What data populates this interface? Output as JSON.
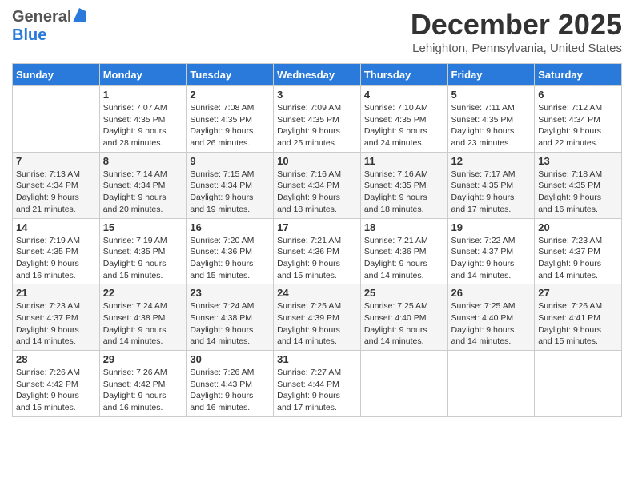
{
  "header": {
    "logo_general": "General",
    "logo_blue": "Blue",
    "month": "December 2025",
    "location": "Lehighton, Pennsylvania, United States"
  },
  "days_of_week": [
    "Sunday",
    "Monday",
    "Tuesday",
    "Wednesday",
    "Thursday",
    "Friday",
    "Saturday"
  ],
  "weeks": [
    [
      {
        "day": "",
        "info": ""
      },
      {
        "day": "1",
        "info": "Sunrise: 7:07 AM\nSunset: 4:35 PM\nDaylight: 9 hours\nand 28 minutes."
      },
      {
        "day": "2",
        "info": "Sunrise: 7:08 AM\nSunset: 4:35 PM\nDaylight: 9 hours\nand 26 minutes."
      },
      {
        "day": "3",
        "info": "Sunrise: 7:09 AM\nSunset: 4:35 PM\nDaylight: 9 hours\nand 25 minutes."
      },
      {
        "day": "4",
        "info": "Sunrise: 7:10 AM\nSunset: 4:35 PM\nDaylight: 9 hours\nand 24 minutes."
      },
      {
        "day": "5",
        "info": "Sunrise: 7:11 AM\nSunset: 4:35 PM\nDaylight: 9 hours\nand 23 minutes."
      },
      {
        "day": "6",
        "info": "Sunrise: 7:12 AM\nSunset: 4:34 PM\nDaylight: 9 hours\nand 22 minutes."
      }
    ],
    [
      {
        "day": "7",
        "info": "Sunrise: 7:13 AM\nSunset: 4:34 PM\nDaylight: 9 hours\nand 21 minutes."
      },
      {
        "day": "8",
        "info": "Sunrise: 7:14 AM\nSunset: 4:34 PM\nDaylight: 9 hours\nand 20 minutes."
      },
      {
        "day": "9",
        "info": "Sunrise: 7:15 AM\nSunset: 4:34 PM\nDaylight: 9 hours\nand 19 minutes."
      },
      {
        "day": "10",
        "info": "Sunrise: 7:16 AM\nSunset: 4:34 PM\nDaylight: 9 hours\nand 18 minutes."
      },
      {
        "day": "11",
        "info": "Sunrise: 7:16 AM\nSunset: 4:35 PM\nDaylight: 9 hours\nand 18 minutes."
      },
      {
        "day": "12",
        "info": "Sunrise: 7:17 AM\nSunset: 4:35 PM\nDaylight: 9 hours\nand 17 minutes."
      },
      {
        "day": "13",
        "info": "Sunrise: 7:18 AM\nSunset: 4:35 PM\nDaylight: 9 hours\nand 16 minutes."
      }
    ],
    [
      {
        "day": "14",
        "info": "Sunrise: 7:19 AM\nSunset: 4:35 PM\nDaylight: 9 hours\nand 16 minutes."
      },
      {
        "day": "15",
        "info": "Sunrise: 7:19 AM\nSunset: 4:35 PM\nDaylight: 9 hours\nand 15 minutes."
      },
      {
        "day": "16",
        "info": "Sunrise: 7:20 AM\nSunset: 4:36 PM\nDaylight: 9 hours\nand 15 minutes."
      },
      {
        "day": "17",
        "info": "Sunrise: 7:21 AM\nSunset: 4:36 PM\nDaylight: 9 hours\nand 15 minutes."
      },
      {
        "day": "18",
        "info": "Sunrise: 7:21 AM\nSunset: 4:36 PM\nDaylight: 9 hours\nand 14 minutes."
      },
      {
        "day": "19",
        "info": "Sunrise: 7:22 AM\nSunset: 4:37 PM\nDaylight: 9 hours\nand 14 minutes."
      },
      {
        "day": "20",
        "info": "Sunrise: 7:23 AM\nSunset: 4:37 PM\nDaylight: 9 hours\nand 14 minutes."
      }
    ],
    [
      {
        "day": "21",
        "info": "Sunrise: 7:23 AM\nSunset: 4:37 PM\nDaylight: 9 hours\nand 14 minutes."
      },
      {
        "day": "22",
        "info": "Sunrise: 7:24 AM\nSunset: 4:38 PM\nDaylight: 9 hours\nand 14 minutes."
      },
      {
        "day": "23",
        "info": "Sunrise: 7:24 AM\nSunset: 4:38 PM\nDaylight: 9 hours\nand 14 minutes."
      },
      {
        "day": "24",
        "info": "Sunrise: 7:25 AM\nSunset: 4:39 PM\nDaylight: 9 hours\nand 14 minutes."
      },
      {
        "day": "25",
        "info": "Sunrise: 7:25 AM\nSunset: 4:40 PM\nDaylight: 9 hours\nand 14 minutes."
      },
      {
        "day": "26",
        "info": "Sunrise: 7:25 AM\nSunset: 4:40 PM\nDaylight: 9 hours\nand 14 minutes."
      },
      {
        "day": "27",
        "info": "Sunrise: 7:26 AM\nSunset: 4:41 PM\nDaylight: 9 hours\nand 15 minutes."
      }
    ],
    [
      {
        "day": "28",
        "info": "Sunrise: 7:26 AM\nSunset: 4:42 PM\nDaylight: 9 hours\nand 15 minutes."
      },
      {
        "day": "29",
        "info": "Sunrise: 7:26 AM\nSunset: 4:42 PM\nDaylight: 9 hours\nand 16 minutes."
      },
      {
        "day": "30",
        "info": "Sunrise: 7:26 AM\nSunset: 4:43 PM\nDaylight: 9 hours\nand 16 minutes."
      },
      {
        "day": "31",
        "info": "Sunrise: 7:27 AM\nSunset: 4:44 PM\nDaylight: 9 hours\nand 17 minutes."
      },
      {
        "day": "",
        "info": ""
      },
      {
        "day": "",
        "info": ""
      },
      {
        "day": "",
        "info": ""
      }
    ]
  ]
}
